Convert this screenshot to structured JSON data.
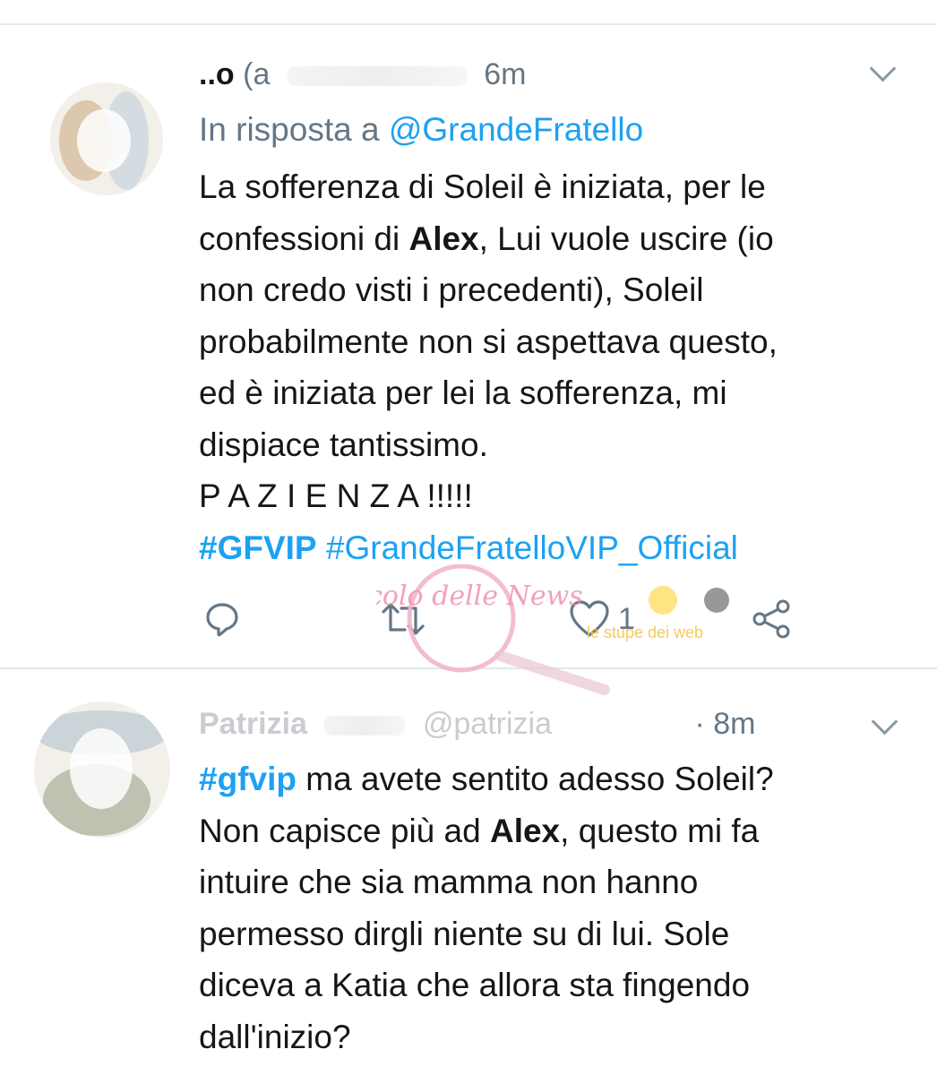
{
  "tweets": [
    {
      "name": "..o",
      "handle": "(a",
      "time": "6m",
      "reply_prefix": "In risposta a",
      "reply_to": "@GrandeFratello",
      "lines": [
        "La sofferenza di Soleil è iniziata, per le",
        "confessioni di",
        "Alex",
        ", Lui vuole uscire (io",
        "non credo visti i precedenti), Soleil",
        "probabilmente non si aspettava questo,",
        "ed è iniziata per lei la sofferenza, mi",
        "dispiace tantissimo.",
        "P A Z I E N Z A !!!!!"
      ],
      "hashtags": [
        "#GFVIP",
        "#GrandeFratelloVIP_Official"
      ],
      "actions": {
        "reply_icon": "reply-icon",
        "retweet_icon": "retweet-icon",
        "like_icon": "heart-icon",
        "like_count": "1",
        "share_icon": "share-icon"
      }
    },
    {
      "name": "Patrizia",
      "handle": "@patrizia",
      "time": "· 8m",
      "hashtag": "#gfvip",
      "lines": [
        " ma avete sentito adesso Soleil?",
        "Non capisce più ad",
        "Alex",
        ", questo mi fa",
        "intuire che sia mamma non hanno",
        "permesso dirgli niente su di lui. Sole",
        "diceva a Katia che allora sta fingendo",
        "dall'inizio?"
      ]
    }
  ],
  "colors": {
    "link": "#1da1f2",
    "text": "#14171a",
    "secondary": "#657786",
    "separator": "#e1e8ed"
  },
  "watermark": {
    "logo_text": "Vicolo delle News",
    "tagline": "le stupe dei web"
  }
}
